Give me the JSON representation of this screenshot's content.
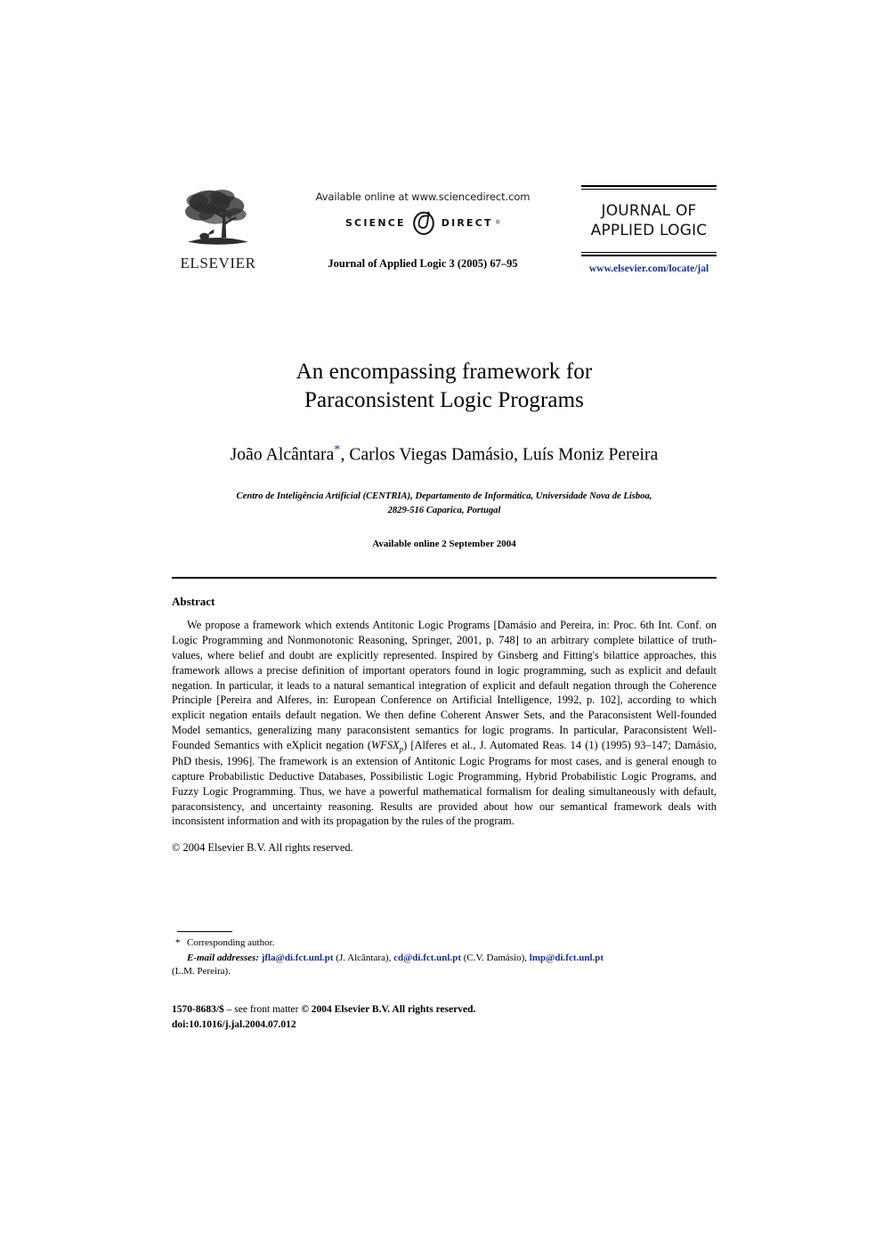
{
  "masthead": {
    "publisher_logo_name": "ELSEVIER",
    "publisher_wordmark": "ELSEVIER",
    "sciencedirect": {
      "available_line": "Available online at www.sciencedirect.com",
      "logo_left": "SCIENCE",
      "logo_right": "DIRECT",
      "registered_mark": "®"
    },
    "citation": "Journal of Applied Logic 3 (2005) 67–95",
    "journal_title_line1": "JOURNAL OF",
    "journal_title_line2": "APPLIED LOGIC",
    "journal_url": "www.elsevier.com/locate/jal"
  },
  "article": {
    "title_line1": "An encompassing framework for",
    "title_line2": "Paraconsistent Logic Programs",
    "authors_prefix": "João Alcântara",
    "corresponding_marker": "*",
    "authors_suffix": ", Carlos Viegas Damásio, Luís Moniz Pereira",
    "affiliation_line1": "Centro de Inteligência Artificial (CENTRIA), Departamento de Informática, Universidade Nova de Lisboa,",
    "affiliation_line2": "2829-516 Caparica, Portugal",
    "available_online": "Available online 2 September 2004"
  },
  "abstract": {
    "heading": "Abstract",
    "part1": "We propose a framework which extends Antitonic Logic Programs [Damásio and Pereira, in: Proc. 6th Int. Conf. on Logic Programming and Nonmonotonic Reasoning, Springer, 2001, p. 748] to an arbitrary complete bilattice of truth-values, where belief and doubt are explicitly represented. Inspired by Ginsberg and Fitting's bilattice approaches, this framework allows a precise definition of important operators found in logic programming, such as explicit and default negation. In particular, it leads to a natural semantical integration of explicit and default negation through the Coherence Principle [Pereira and Alferes, in: European Conference on Artificial Intelligence, 1992, p. 102], according to which explicit negation entails default negation. We then define Coherent Answer Sets, and the Paraconsistent Well-founded Model semantics, generalizing many paraconsistent semantics for logic programs. In particular, Paraconsistent Well-Founded Semantics with eXplicit negation (",
    "wfsx_main": "WFSX",
    "wfsx_sub": "p",
    "part2": ") [Alferes et al., J. Automated Reas. 14 (1) (1995) 93–147; Damásio, PhD thesis, 1996]. The framework is an extension of Antitonic Logic Programs for most cases, and is general enough to capture Probabilistic Deductive Databases, Possibilistic Logic Programming, Hybrid Probabilistic Logic Programs, and Fuzzy Logic Programming. Thus, we have a powerful mathematical formalism for dealing simultaneously with default, paraconsistency, and uncertainty reasoning. Results are provided about how our semantical framework deals with inconsistent information and with its propagation by the rules of the program.",
    "copyright": "© 2004 Elsevier B.V. All rights reserved."
  },
  "footnotes": {
    "corresponding_marker": "*",
    "corresponding_text": "Corresponding author.",
    "email_label": "E-mail addresses:",
    "emails": [
      {
        "address": "jfla@di.fct.unl.pt",
        "person": "(J. Alcântara)",
        "separator": ","
      },
      {
        "address": "cd@di.fct.unl.pt",
        "person": "(C.V. Damásio)",
        "separator": ","
      },
      {
        "address": "lmp@di.fct.unl.pt",
        "person": "(L.M. Pereira)",
        "separator": "."
      }
    ]
  },
  "imprint": {
    "issn_line_bold_start": "1570-8683/$",
    "issn_line_rest": " – see front matter",
    "issn_line_bold_end": " © 2004 Elsevier B.V. All rights reserved.",
    "doi": "doi:10.1016/j.jal.2004.07.012"
  },
  "colors": {
    "link_blue": "#1b2f8a",
    "text_black": "#000000",
    "page_background": "#ffffff"
  }
}
